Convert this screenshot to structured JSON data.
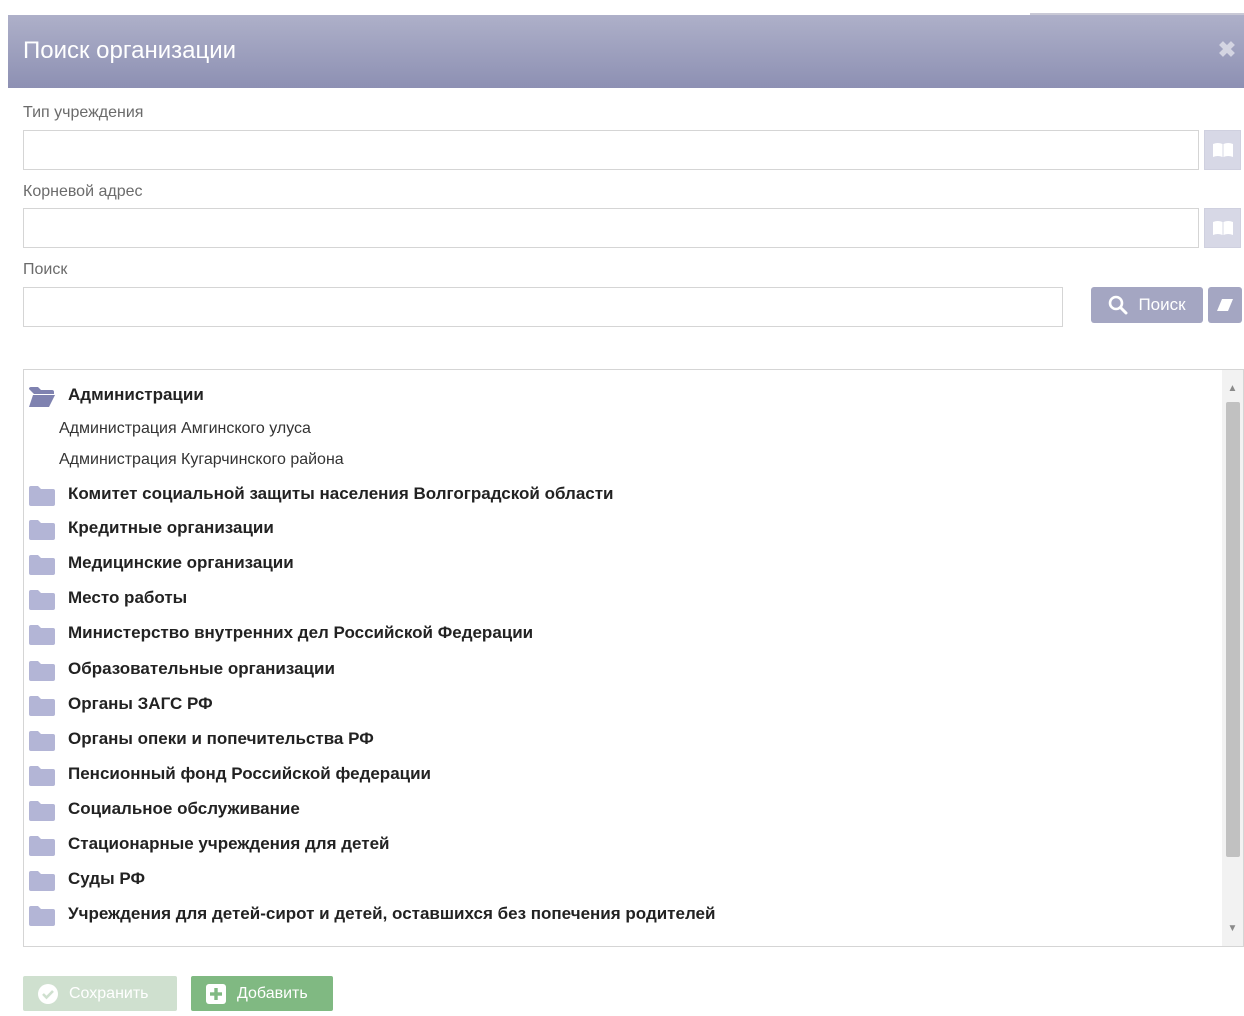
{
  "dialog": {
    "title": "Поиск организации",
    "close_symbol": "✖"
  },
  "fields": {
    "type": {
      "label": "Тип учреждения",
      "value": "",
      "placeholder": ""
    },
    "root_address": {
      "label": "Корневой адрес",
      "value": "",
      "placeholder": ""
    },
    "search": {
      "label": "Поиск",
      "value": "",
      "placeholder": ""
    }
  },
  "buttons": {
    "search_label": "Поиск",
    "save_label": "Сохранить",
    "add_label": "Добавить"
  },
  "tree": {
    "items": [
      {
        "label": "Администрации",
        "kind": "group",
        "expanded": true
      },
      {
        "label": "Администрация Амгинского улуса",
        "kind": "child"
      },
      {
        "label": "Администрация Кугарчинского района",
        "kind": "child"
      },
      {
        "label": "Комитет социальной защиты населения Волгоградской области",
        "kind": "group"
      },
      {
        "label": "Кредитные организации",
        "kind": "group"
      },
      {
        "label": "Медицинские организации",
        "kind": "group"
      },
      {
        "label": "Место работы",
        "kind": "group"
      },
      {
        "label": "Министерство внутренних дел Российской Федерации",
        "kind": "group"
      },
      {
        "label": "Образовательные организации",
        "kind": "group"
      },
      {
        "label": "Органы ЗАГС РФ",
        "kind": "group"
      },
      {
        "label": "Органы опеки и попечительства РФ",
        "kind": "group"
      },
      {
        "label": "Пенсионный фонд Российской федерации",
        "kind": "group"
      },
      {
        "label": "Социальное обслуживание",
        "kind": "group"
      },
      {
        "label": "Стационарные учреждения для детей",
        "kind": "group"
      },
      {
        "label": "Суды РФ",
        "kind": "group"
      },
      {
        "label": "Учреждения для детей-сирот и детей, оставшихся без попечения родителей",
        "kind": "group"
      }
    ]
  },
  "colors": {
    "header": "#9a9cbc",
    "button_primary": "#a4a6c2",
    "folder": "#b3b5d6",
    "folder_open": "#7f82b0",
    "add_button": "#80b982",
    "save_button_disabled": "#cfe0cf"
  },
  "icons": {
    "close": "close-icon",
    "dictionary": "book-icon",
    "search": "search-icon",
    "clear": "eraser-icon",
    "folder": "folder-icon",
    "folder_open": "folder-open-icon",
    "save": "check-circle-icon",
    "add": "plus-square-icon"
  }
}
